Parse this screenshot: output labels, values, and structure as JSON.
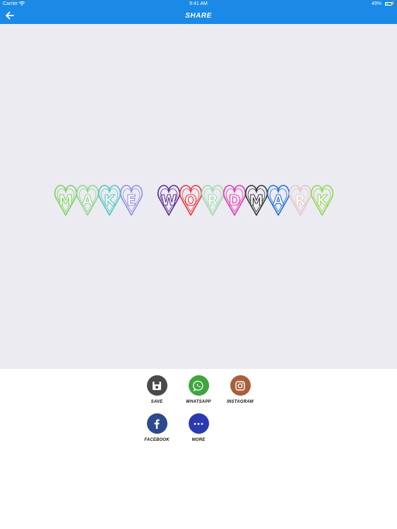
{
  "status_bar": {
    "carrier": "Carrier",
    "time": "9:41 AM",
    "battery_text": "49%",
    "battery_level": 0.49
  },
  "nav": {
    "title": "SHARE",
    "back_icon": "arrow-left-icon"
  },
  "preview": {
    "wordmark_text": "MAKE WORDMARK",
    "letters": [
      {
        "char": "M",
        "color": "#7ed060"
      },
      {
        "char": "A",
        "color": "#8fd48a"
      },
      {
        "char": "K",
        "color": "#4fc6c0"
      },
      {
        "char": "E",
        "color": "#8f8fe8"
      },
      {
        "char": "W",
        "color": "#5a2a8e"
      },
      {
        "char": "O",
        "color": "#e8333a"
      },
      {
        "char": "R",
        "color": "#9ed8a8"
      },
      {
        "char": "D",
        "color": "#e033b0"
      },
      {
        "char": "M",
        "color": "#333333"
      },
      {
        "char": "A",
        "color": "#1e6fd0"
      },
      {
        "char": "R",
        "color": "#e2c6c6"
      },
      {
        "char": "K",
        "color": "#8ed650"
      }
    ]
  },
  "share_options": [
    {
      "label": "SAVE",
      "icon": "floppy-disk-icon",
      "color": "#4a4a4a"
    },
    {
      "label": "WHATSAPP",
      "icon": "whatsapp-icon",
      "color": "#3fa63f"
    },
    {
      "label": "INSTAGRAM",
      "icon": "instagram-icon",
      "color": "#a8603a"
    },
    {
      "label": "FACEBOOK",
      "icon": "facebook-icon",
      "color": "#2b4a8f"
    },
    {
      "label": "MORE",
      "icon": "more-dots-icon",
      "color": "#2c3ab0"
    }
  ],
  "colors": {
    "header_blue": "#1a8ae6",
    "preview_background": "#ebebf1"
  }
}
